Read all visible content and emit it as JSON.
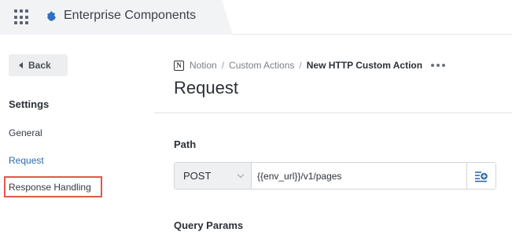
{
  "header": {
    "app_title": "Enterprise Components",
    "apps_icon": "grid-icon",
    "logo_icon": "puzzle-icon"
  },
  "sidebar": {
    "back_label": "Back",
    "section_title": "Settings",
    "items": [
      {
        "label": "General",
        "active": false
      },
      {
        "label": "Request",
        "active": true
      },
      {
        "label": "Response Handling",
        "active": false,
        "highlighted": true
      }
    ]
  },
  "breadcrumb": {
    "items": [
      "Notion",
      "Custom Actions",
      "New HTTP Custom Action"
    ],
    "separator": "/",
    "icon": "notion-icon",
    "more_icon": "more-horizontal-icon"
  },
  "page": {
    "title": "Request"
  },
  "path": {
    "label": "Path",
    "method": "POST",
    "url": "{{env_url}}/v1/pages",
    "add_icon": "add-variable-icon"
  },
  "query_params": {
    "label": "Query Params"
  },
  "colors": {
    "accent": "#2a6bb3",
    "highlight": "#e0584c",
    "logo": "#2f6fc4"
  }
}
